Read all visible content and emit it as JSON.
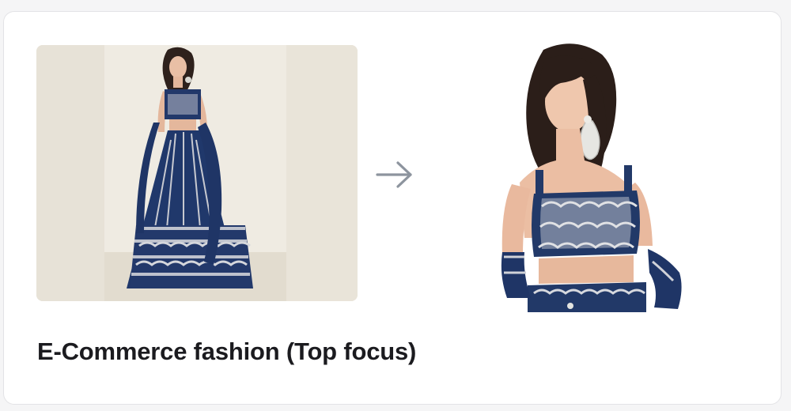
{
  "card": {
    "caption": "E-Commerce fashion (Top focus)",
    "before_image": {
      "alt": "model wearing navy embroidered lehenga, full length"
    },
    "after_image": {
      "alt": "cropped model wearing navy embroidered blouse, top focus"
    },
    "arrow_icon": "arrow-right-icon"
  },
  "colors": {
    "navy": "#1f3566",
    "silver": "#c9cbd3",
    "arrow": "#8d949e",
    "caption": "#1b1b1f"
  }
}
